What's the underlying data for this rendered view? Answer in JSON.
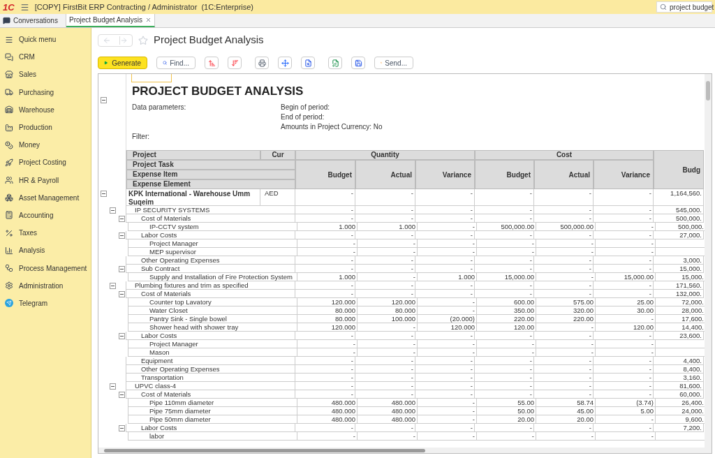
{
  "top_bar": {
    "logo": "1С",
    "title": "[COPY] FirstBit ERP Contracting / Administrator  (1C:Enterprise)",
    "search": {
      "value": "project budget"
    }
  },
  "tabs": [
    {
      "label": "Conversations",
      "kind": "home",
      "selected": false
    },
    {
      "label": "Project Budget Analysis",
      "kind": "document",
      "selected": true
    }
  ],
  "sidebar": {
    "items": [
      {
        "label": "Quick menu"
      },
      {
        "label": "CRM"
      },
      {
        "label": "Sales"
      },
      {
        "label": "Purchasing"
      },
      {
        "label": "Warehouse"
      },
      {
        "label": "Production"
      },
      {
        "label": "Money"
      },
      {
        "label": "Project Costing"
      },
      {
        "label": "HR & Payroll"
      },
      {
        "label": "Asset Management"
      },
      {
        "label": "Accounting"
      },
      {
        "label": "Taxes"
      },
      {
        "label": "Analysis"
      },
      {
        "label": "Process Management"
      },
      {
        "label": "Administration"
      },
      {
        "label": "Telegram"
      }
    ]
  },
  "page": {
    "title": "Project Budget Analysis",
    "favorite": false
  },
  "toolbar": [
    {
      "kind": "primary",
      "label": "Generate"
    },
    {
      "kind": "text",
      "label": "Find..."
    },
    {
      "kind": "icon"
    },
    {
      "kind": "icon"
    },
    {
      "kind": "icon"
    },
    {
      "kind": "icon"
    },
    {
      "kind": "icon"
    },
    {
      "kind": "icon"
    },
    {
      "kind": "icon"
    },
    {
      "kind": "text",
      "label": "Send..."
    }
  ],
  "report": {
    "title": "PROJECT BUDGET ANALYSIS",
    "params_label": "Data parameters:",
    "params": [
      "Begin of period:",
      "End of period:",
      "Amounts in Project Currency: No"
    ],
    "filter_label": "Filter:",
    "header": {
      "project": "Project",
      "cur": "Cur",
      "levels": [
        "Project Task",
        "Expense Item",
        "Expense Element"
      ],
      "groups": [
        {
          "label": "Quantity",
          "columns": [
            "Budget",
            "Actual",
            "Variance"
          ]
        },
        {
          "label": "Cost",
          "columns": [
            "Budget",
            "Actual",
            "Variance"
          ]
        }
      ],
      "extra_column": "Budg"
    },
    "rows": [
      {
        "label": "KPK International - Warehouse Umm Suqeim",
        "cur": "AED",
        "expanded": true,
        "values": [
          "-",
          "-",
          "-",
          "-",
          "-",
          "-",
          "1,164,560."
        ],
        "children": [
          {
            "label": "IP SECURITY SYSTEMS",
            "expanded": true,
            "values": [
              "-",
              "-",
              "-",
              "-",
              "-",
              "-",
              "545,000."
            ],
            "children": [
              {
                "label": "Cost of Materials",
                "expanded": true,
                "values": [
                  "-",
                  "-",
                  "-",
                  "-",
                  "-",
                  "-",
                  "500,000."
                ],
                "children": [
                  {
                    "label": "IP-CCTV system",
                    "values": [
                      "1.000",
                      "1.000",
                      "-",
                      "500,000.00",
                      "500,000.00",
                      "-",
                      "500,000."
                    ]
                  }
                ]
              },
              {
                "label": "Labor Costs",
                "expanded": true,
                "values": [
                  "-",
                  "-",
                  "-",
                  "-",
                  "-",
                  "-",
                  "27,000."
                ],
                "children": [
                  {
                    "label": "Project Manager",
                    "values": [
                      "-",
                      "-",
                      "-",
                      "-",
                      "-",
                      "-"
                    ]
                  },
                  {
                    "label": "MEP supervisor",
                    "values": [
                      "-",
                      "-",
                      "-",
                      "-",
                      "-",
                      "-"
                    ]
                  }
                ]
              },
              {
                "label": "Other Operating Expenses",
                "values": [
                  "-",
                  "-",
                  "-",
                  "-",
                  "-",
                  "-",
                  "3,000."
                ]
              },
              {
                "label": "Sub Contract",
                "expanded": true,
                "values": [
                  "-",
                  "-",
                  "-",
                  "-",
                  "-",
                  "-",
                  "15,000."
                ],
                "children": [
                  {
                    "label": "Supply and Installation of Fire Protection System",
                    "values": [
                      "1.000",
                      "-",
                      "1.000",
                      "15,000.00",
                      "-",
                      "15,000.00",
                      "15,000."
                    ]
                  }
                ]
              }
            ]
          },
          {
            "label": "Plumbing fixtures and trim as specified",
            "expanded": true,
            "values": [
              "-",
              "-",
              "-",
              "-",
              "-",
              "-",
              "171,560."
            ],
            "children": [
              {
                "label": "Cost of Materials",
                "expanded": true,
                "values": [
                  "-",
                  "-",
                  "-",
                  "-",
                  "-",
                  "-",
                  "132,000."
                ],
                "children": [
                  {
                    "label": "Counter top Lavatory",
                    "values": [
                      "120.000",
                      "120.000",
                      "-",
                      "600.00",
                      "575.00",
                      "25.00",
                      "72,000."
                    ]
                  },
                  {
                    "label": "Water Closet",
                    "values": [
                      "80.000",
                      "80.000",
                      "-",
                      "350.00",
                      "320.00",
                      "30.00",
                      "28,000."
                    ]
                  },
                  {
                    "label": "Pantry Sink - Single bowel",
                    "values": [
                      "80.000",
                      "100.000",
                      "(20.000)",
                      "220.00",
                      "220.00",
                      "-",
                      "17,600."
                    ]
                  },
                  {
                    "label": "Shower head with shower tray",
                    "values": [
                      "120.000",
                      "-",
                      "120.000",
                      "120.00",
                      "-",
                      "120.00",
                      "14,400."
                    ]
                  }
                ]
              },
              {
                "label": "Labor Costs",
                "expanded": true,
                "values": [
                  "-",
                  "-",
                  "-",
                  "-",
                  "-",
                  "-",
                  "23,600."
                ],
                "children": [
                  {
                    "label": "Project Manager",
                    "values": [
                      "-",
                      "-",
                      "-",
                      "-",
                      "-",
                      "-"
                    ]
                  },
                  {
                    "label": "Mason",
                    "values": [
                      "-",
                      "-",
                      "-",
                      "-",
                      "-",
                      "-"
                    ]
                  }
                ]
              },
              {
                "label": "Equipment",
                "values": [
                  "-",
                  "-",
                  "-",
                  "-",
                  "-",
                  "-",
                  "4,400."
                ]
              },
              {
                "label": "Other Operating Expenses",
                "values": [
                  "-",
                  "-",
                  "-",
                  "-",
                  "-",
                  "-",
                  "8,400."
                ]
              },
              {
                "label": "Transportation",
                "values": [
                  "-",
                  "-",
                  "-",
                  "-",
                  "-",
                  "-",
                  "3,160."
                ]
              }
            ]
          },
          {
            "label": "UPVC class-4",
            "expanded": true,
            "values": [
              "-",
              "-",
              "-",
              "-",
              "-",
              "-",
              "81,600."
            ],
            "children": [
              {
                "label": "Cost of Materials",
                "expanded": true,
                "values": [
                  "-",
                  "-",
                  "-",
                  "-",
                  "-",
                  "-",
                  "60,000."
                ],
                "children": [
                  {
                    "label": "Pipe 110mm diameter",
                    "values": [
                      "480.000",
                      "480.000",
                      "-",
                      "55.00",
                      "58.74",
                      "(3.74)",
                      "26,400."
                    ]
                  },
                  {
                    "label": "Pipe 75mm diameter",
                    "values": [
                      "480.000",
                      "480.000",
                      "-",
                      "50.00",
                      "45.00",
                      "5.00",
                      "24,000."
                    ]
                  },
                  {
                    "label": "Pipe 50mm diameter",
                    "values": [
                      "480.000",
                      "480.000",
                      "-",
                      "20.00",
                      "20.00",
                      "-",
                      "9,600."
                    ]
                  }
                ]
              },
              {
                "label": "Labor Costs",
                "expanded": true,
                "values": [
                  "-",
                  "-",
                  "-",
                  "-",
                  "-",
                  "-",
                  "7,200."
                ],
                "children": [
                  {
                    "label": "labor",
                    "values": [
                      "-",
                      "-",
                      "-",
                      "-",
                      "-",
                      "-"
                    ]
                  }
                ]
              }
            ]
          }
        ]
      }
    ]
  }
}
